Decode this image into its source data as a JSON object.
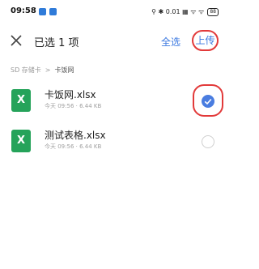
{
  "status_bar": {
    "time": "09:58",
    "indicators": "⚲ ✱ 0.01 ▦ ᯤ ᯤ",
    "battery": "88"
  },
  "toolbar": {
    "close_icon": "close-icon",
    "title": "已选 1 项",
    "select_all_label": "全选",
    "upload_label": "上传"
  },
  "breadcrumb": {
    "root": "SD 存储卡",
    "separator": ">",
    "current": "卡饭网"
  },
  "files": [
    {
      "icon": "excel-file-icon",
      "icon_letter": "X",
      "name": "卡饭网.xlsx",
      "meta": "今天 09:56 · 6.44 KB",
      "selected": true
    },
    {
      "icon": "excel-file-icon",
      "icon_letter": "X",
      "name": "测试表格.xlsx",
      "meta": "今天 09:56 · 6.44 KB",
      "selected": false
    }
  ],
  "colors": {
    "accent": "#3a78e0",
    "highlight": "#e23a3a",
    "excel_green": "#25a35a"
  }
}
